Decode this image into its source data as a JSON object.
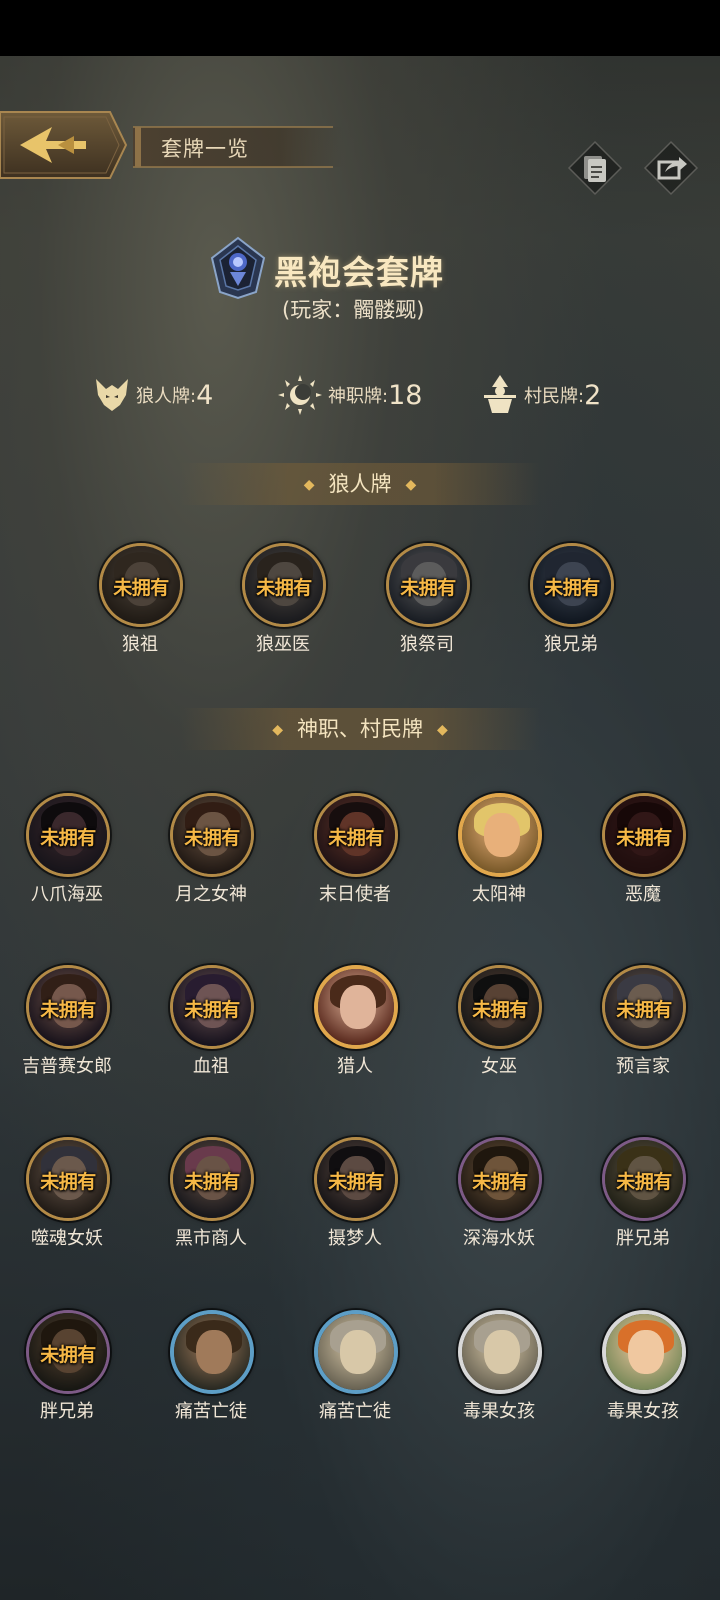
{
  "header": {
    "title": "套牌一览"
  },
  "deck": {
    "name": "黑袍会套牌",
    "owner": "(玩家：髑髅觋)"
  },
  "counts": [
    {
      "label": "狼人牌:",
      "value": "4"
    },
    {
      "label": "神职牌:",
      "value": "18"
    },
    {
      "label": "村民牌:",
      "value": "2"
    }
  ],
  "sections": {
    "werewolf": "狼人牌",
    "gods_villagers": "神职、村民牌"
  },
  "badge_text": "未拥有",
  "werewolf_cards": [
    {
      "name": "狼祖",
      "owned": false
    },
    {
      "name": "狼巫医",
      "owned": false
    },
    {
      "name": "狼祭司",
      "owned": false
    },
    {
      "name": "狼兄弟",
      "owned": false
    }
  ],
  "other_cards": [
    {
      "name": "八爪海巫",
      "owned": false
    },
    {
      "name": "月之女神",
      "owned": false
    },
    {
      "name": "末日使者",
      "owned": false
    },
    {
      "name": "太阳神",
      "owned": true
    },
    {
      "name": "恶魔",
      "owned": false
    },
    {
      "name": "吉普赛女郎",
      "owned": false
    },
    {
      "name": "血祖",
      "owned": false
    },
    {
      "name": "猎人",
      "owned": true
    },
    {
      "name": "女巫",
      "owned": false
    },
    {
      "name": "预言家",
      "owned": false
    },
    {
      "name": "噬魂女妖",
      "owned": false
    },
    {
      "name": "黑市商人",
      "owned": false
    },
    {
      "name": "摄梦人",
      "owned": false
    },
    {
      "name": "深海水妖",
      "owned": false
    },
    {
      "name": "胖兄弟",
      "owned": false
    },
    {
      "name": "胖兄弟",
      "owned": false
    },
    {
      "name": "痛苦亡徒",
      "owned": true
    },
    {
      "name": "痛苦亡徒",
      "owned": true
    },
    {
      "name": "毒果女孩",
      "owned": true
    },
    {
      "name": "毒果女孩",
      "owned": true
    }
  ],
  "colors": {
    "accent_gold": "#e1a74c",
    "badge": "#f6b846",
    "text": "#f0e6d6"
  },
  "icons": [
    "back-arrow-icon",
    "deck-list-icon",
    "share-icon",
    "wolf-icon",
    "sun-icon",
    "villager-icon",
    "deck-emblem-icon"
  ]
}
